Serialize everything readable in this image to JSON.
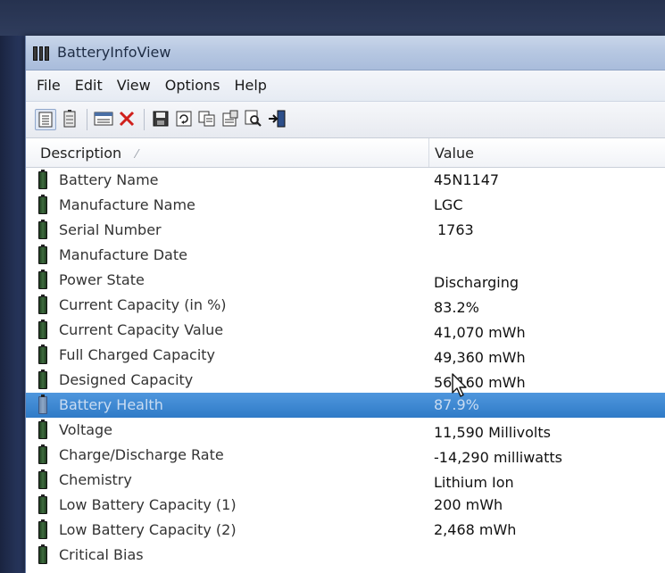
{
  "window": {
    "title": "BatteryInfoView"
  },
  "menu": [
    {
      "label": "File"
    },
    {
      "label": "Edit"
    },
    {
      "label": "View"
    },
    {
      "label": "Options"
    },
    {
      "label": "Help"
    }
  ],
  "toolbar": {
    "icons": [
      "details-view-icon",
      "battery-view-icon",
      "log-view-icon",
      "delete-icon",
      "save-icon",
      "refresh-icon",
      "copy-icon",
      "properties-icon",
      "find-icon",
      "exit-icon"
    ]
  },
  "columns": {
    "description": "Description",
    "value": "Value"
  },
  "rows": [
    {
      "description": "Battery Name",
      "value": "45N1147"
    },
    {
      "description": "Manufacture Name",
      "value": "LGC"
    },
    {
      "description": "Serial Number",
      "value": "1763"
    },
    {
      "description": "Manufacture Date",
      "value": ""
    },
    {
      "description": "Power State",
      "value": "Discharging"
    },
    {
      "description": "Current Capacity (in %)",
      "value": "83.2%"
    },
    {
      "description": "Current Capacity Value",
      "value": "41,070 mWh"
    },
    {
      "description": "Full Charged Capacity",
      "value": "49,360 mWh"
    },
    {
      "description": "Designed Capacity",
      "value": "56,160 mWh"
    },
    {
      "description": "Battery Health",
      "value": "87.9%"
    },
    {
      "description": "Voltage",
      "value": "11,590 Millivolts"
    },
    {
      "description": "Charge/Discharge Rate",
      "value": "-14,290 milliwatts"
    },
    {
      "description": "Chemistry",
      "value": "Lithium Ion"
    },
    {
      "description": "Low Battery Capacity (1)",
      "value": "200 mWh"
    },
    {
      "description": "Low Battery Capacity (2)",
      "value": "2,468 mWh"
    },
    {
      "description": "Critical Bias",
      "value": ""
    }
  ],
  "selected_row": "Battery Health",
  "colors": {
    "selection": "#2f7bc7",
    "title_bar": "#b7c8e2",
    "battery_icon": "#2f4f2f"
  }
}
